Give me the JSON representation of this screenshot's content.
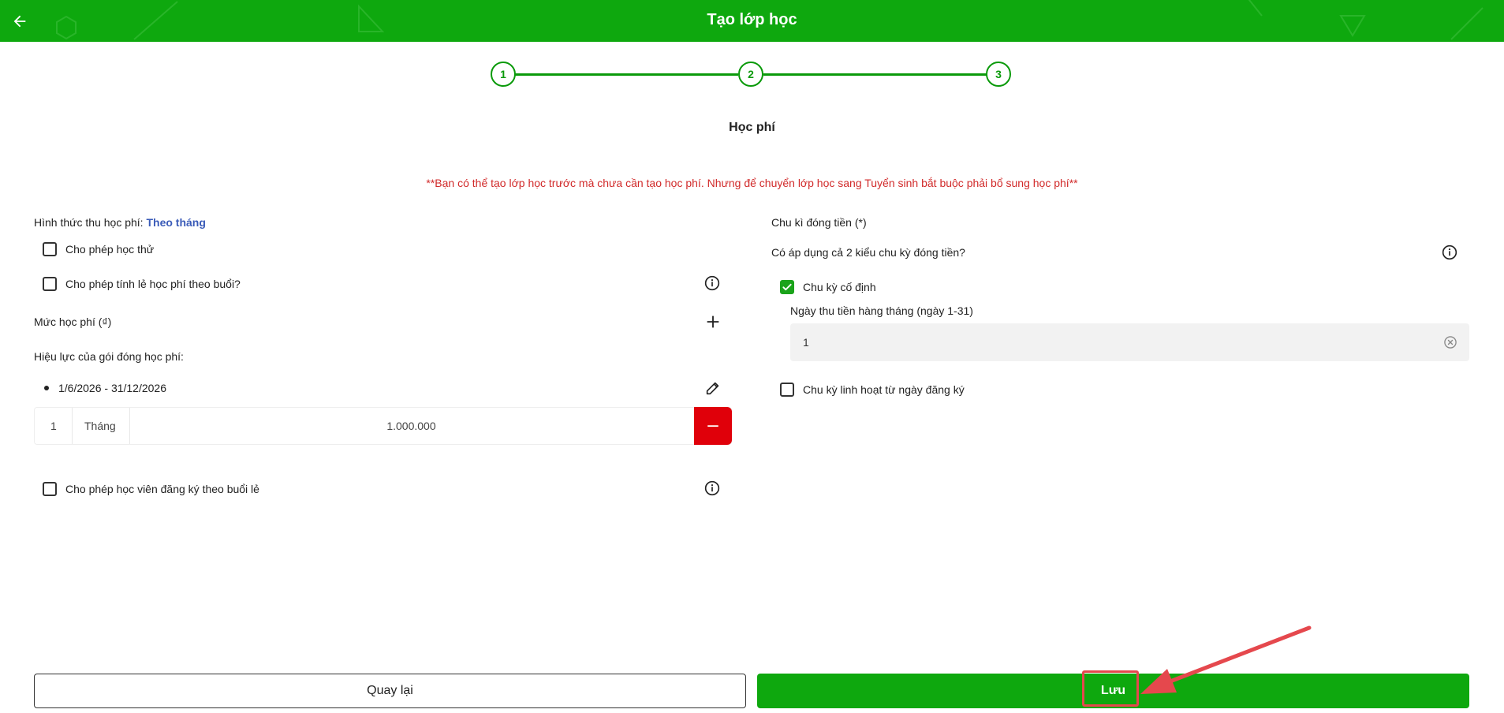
{
  "header": {
    "title": "Tạo lớp học",
    "back_icon": "arrow-left-icon",
    "bg_color": "#0ea80e"
  },
  "stepper": {
    "steps": [
      "1",
      "2",
      "3"
    ],
    "color": "#0a9a0a"
  },
  "section_title": "Học phí",
  "notice": "**Bạn có thể tạo lớp học trước mà chưa cần tạo học phí. Nhưng để chuyển lớp học sang Tuyển sinh bắt buộc phải bổ sung học phí**",
  "left": {
    "fee_type_label": "Hình thức thu học phí:",
    "fee_type_value": "Theo tháng",
    "allow_trial": "Cho phép học thử",
    "allow_prorate": "Cho phép tính lẻ học phí theo buổi?",
    "fee_level": "Mức học phí (₫)",
    "validity_label": "Hiệu lực của gói đóng học phí:",
    "validity_range": "1/6/2026 - 31/12/2026",
    "fee_row": {
      "quantity": "1",
      "unit": "Tháng",
      "amount": "1.000.000"
    },
    "allow_single_session": "Cho phép học viên đăng ký theo buổi lẻ"
  },
  "right": {
    "cycle_label": "Chu kì đóng tiền (*)",
    "apply_both": "Có áp dụng cả 2 kiểu chu kỳ đóng tiền?",
    "fixed_cycle": "Chu kỳ cố định",
    "collection_day_label": "Ngày thu tiền hàng tháng (ngày 1-31)",
    "collection_day_value": "1",
    "flexible_cycle": "Chu kỳ linh hoạt từ ngày đăng ký"
  },
  "buttons": {
    "back": "Quay lại",
    "save": "Lưu"
  },
  "colors": {
    "primary_green": "#0ea80e",
    "danger_red": "#e0000a",
    "notice_red": "#d12a2a",
    "accent_blue": "#3a5bb8",
    "annotation_red": "#e5484d"
  }
}
